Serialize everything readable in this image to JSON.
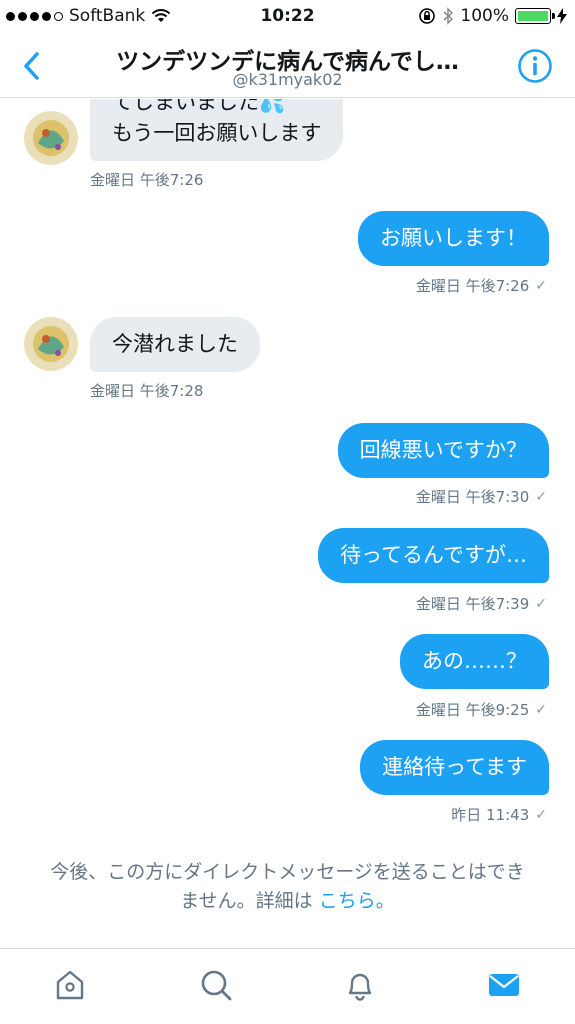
{
  "status_bar": {
    "carrier": "SoftBank",
    "time": "10:22",
    "battery": "100%",
    "battery_level": 1.0,
    "signal_icon": "signal-dots",
    "wifi_icon": "wifi-icon",
    "lock_icon": "orientation-lock-icon",
    "bluetooth_icon": "bluetooth-icon"
  },
  "header": {
    "title": "ツンデツンデに病んで病んでし…",
    "handle": "@k31myak02",
    "back_icon": "chevron-left-icon",
    "info_icon": "info-icon"
  },
  "messages": [
    {
      "direction": "in",
      "lines": [
        "てしまいました💦",
        "もう一回お願いします"
      ],
      "time": "金曜日 午後7:26"
    },
    {
      "direction": "out",
      "text": "お願いします！",
      "time": "金曜日 午後7:26"
    },
    {
      "direction": "in",
      "text": "今潜れました",
      "time": "金曜日 午後7:28"
    },
    {
      "direction": "out",
      "text": "回線悪いですか？",
      "time": "金曜日 午後7:30"
    },
    {
      "direction": "out",
      "text": "待ってるんですが…",
      "time": "金曜日 午後7:39"
    },
    {
      "direction": "out",
      "text": "あの……？",
      "time": "金曜日 午後9:25"
    },
    {
      "direction": "out",
      "text": "連絡待ってます",
      "time": "昨日 11:43"
    }
  ],
  "read_mark": "✓",
  "notice": {
    "text_line1": "今後、この方にダイレクトメッセージを送ることはでき",
    "text_line2": "ません。詳細は",
    "link": "こちら。"
  },
  "tab_bar": {
    "tabs": [
      "home-icon",
      "search-icon",
      "notifications-icon",
      "messages-icon"
    ],
    "active": "messages-icon"
  },
  "colors": {
    "accent": "#1da1f2",
    "incoming_bubble": "#e6ecf0",
    "muted_text": "#657786",
    "inactive_tab": "#657786"
  }
}
